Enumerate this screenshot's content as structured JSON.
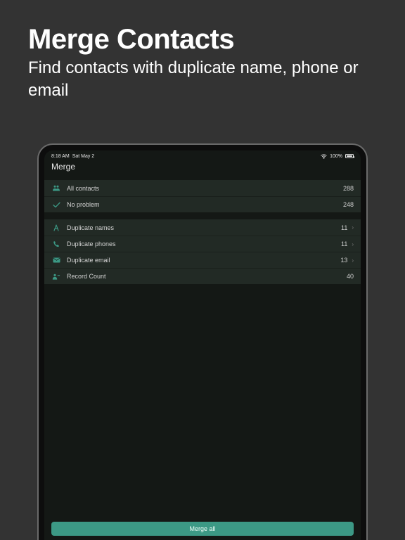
{
  "hero": {
    "title": "Merge Contacts",
    "subtitle": "Find contacts with duplicate name, phone or email"
  },
  "status": {
    "time": "8:18 AM",
    "date": "Sat May 2",
    "battery_pct": "100%"
  },
  "page": {
    "title": "Merge"
  },
  "summary": [
    {
      "label": "All contacts",
      "count": "288"
    },
    {
      "label": "No problem",
      "count": "248"
    }
  ],
  "duplicates": [
    {
      "label": "Duplicate names",
      "count": "11"
    },
    {
      "label": "Duplicate phones",
      "count": "11"
    },
    {
      "label": "Duplicate email",
      "count": "13"
    },
    {
      "label": "Record Count",
      "count": "40"
    }
  ],
  "actions": {
    "merge_all": "Merge all"
  }
}
